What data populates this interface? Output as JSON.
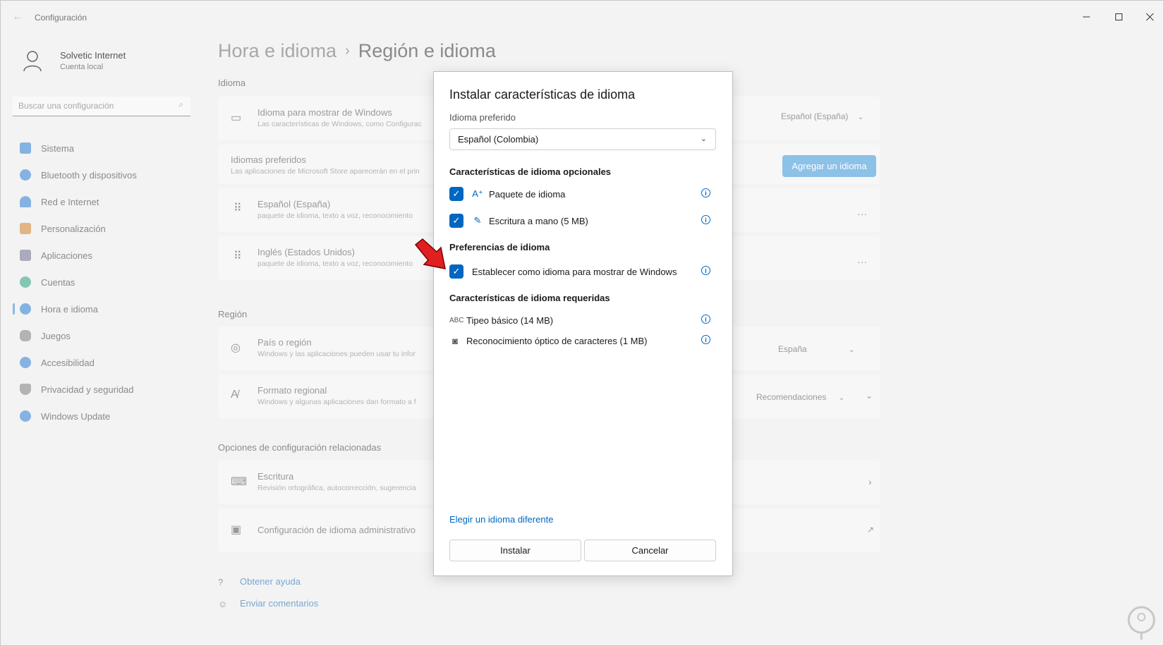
{
  "window": {
    "title": "Configuración"
  },
  "user": {
    "name": "Solvetic Internet",
    "account_type": "Cuenta local"
  },
  "search": {
    "placeholder": "Buscar una configuración"
  },
  "sidebar": {
    "items": [
      {
        "label": "Sistema",
        "icon": "monitor-icon",
        "color": "#3a88d8"
      },
      {
        "label": "Bluetooth y dispositivos",
        "icon": "bluetooth-icon",
        "color": "#3a88d8"
      },
      {
        "label": "Red e Internet",
        "icon": "wifi-icon",
        "color": "#3a88d8"
      },
      {
        "label": "Personalización",
        "icon": "brush-icon",
        "color": "#d88a3a"
      },
      {
        "label": "Aplicaciones",
        "icon": "apps-icon",
        "color": "#7a7a9a"
      },
      {
        "label": "Cuentas",
        "icon": "person-icon",
        "color": "#3aa88a"
      },
      {
        "label": "Hora e idioma",
        "icon": "globe-clock-icon",
        "color": "#3a88d8",
        "active": true
      },
      {
        "label": "Juegos",
        "icon": "gamepad-icon",
        "color": "#888888"
      },
      {
        "label": "Accesibilidad",
        "icon": "accessibility-icon",
        "color": "#3a88d8"
      },
      {
        "label": "Privacidad y seguridad",
        "icon": "shield-icon",
        "color": "#888888"
      },
      {
        "label": "Windows Update",
        "icon": "update-icon",
        "color": "#3a88d8"
      }
    ]
  },
  "breadcrumb": {
    "parent": "Hora e idioma",
    "separator": "›",
    "current": "Región e idioma"
  },
  "idioma": {
    "heading": "Idioma",
    "display_title": "Idioma para mostrar de Windows",
    "display_sub": "Las características de Windows, como Configurac",
    "display_value": "Español (España)",
    "preferred_title": "Idiomas preferidos",
    "preferred_sub": "Las aplicaciones de Microsoft Store aparecerán en el prin",
    "add_button": "Agregar un idioma",
    "languages": [
      {
        "title": "Español (España)",
        "sub": "paquete de idioma, texto a voz, reconocimiento"
      },
      {
        "title": "Inglés (Estados Unidos)",
        "sub": "paquete de idioma, texto a voz, reconocimiento"
      }
    ],
    "more": "···"
  },
  "region": {
    "heading": "Región",
    "country_title": "País o región",
    "country_sub": "Windows y las aplicaciones pueden usar tu infor",
    "country_value": "España",
    "format_title": "Formato regional",
    "format_sub": "Windows y algunas aplicaciones dan formato a f",
    "format_value": "Recomendaciones"
  },
  "related": {
    "heading": "Opciones de configuración relacionadas",
    "typing_title": "Escritura",
    "typing_sub": "Revisión ortográfica, autocorrección, sugerencia",
    "admin_title": "Configuración de idioma administrativo"
  },
  "help": {
    "get_help": "Obtener ayuda",
    "feedback": "Enviar comentarios"
  },
  "dialog": {
    "title": "Instalar características de idioma",
    "preferred_label": "Idioma preferido",
    "preferred_value": "Español (Colombia)",
    "optional_heading": "Características de idioma opcionales",
    "optional": [
      {
        "label": "Paquete de idioma",
        "checked": true
      },
      {
        "label": "Escritura a mano (5 MB)",
        "checked": true
      }
    ],
    "prefs_heading": "Preferencias de idioma",
    "prefs": [
      {
        "label": "Establecer como idioma para mostrar de Windows",
        "checked": true
      }
    ],
    "required_heading": "Características de idioma requeridas",
    "required": [
      {
        "label": "Tipeo básico (14 MB)",
        "icon_text": "ABC"
      },
      {
        "label": "Reconocimiento óptico de caracteres (1 MB)"
      }
    ],
    "choose_other": "Elegir un idioma diferente",
    "install": "Instalar",
    "cancel": "Cancelar"
  },
  "colors": {
    "accent": "#0067c0",
    "arrow": "#e02020"
  }
}
